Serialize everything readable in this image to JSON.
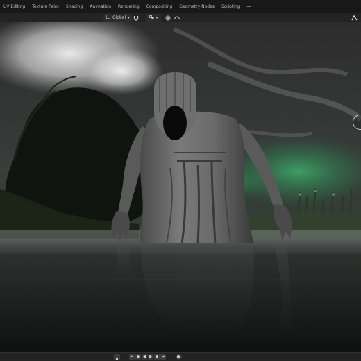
{
  "workspace_tabs": [
    "UV Editing",
    "Texture Paint",
    "Shading",
    "Animation",
    "Rendering",
    "Compositing",
    "Geometry Nodes",
    "Scripting"
  ],
  "add_workspace_label": "+",
  "viewport_header": {
    "transform_orientation": "Global",
    "snap_increment_label": "",
    "icons": {
      "orientation": "orientation-icon",
      "snap": "magnet-icon",
      "snap_increment": "snap-increment-icon",
      "proportional": "proportional-edit-icon",
      "falloff": "falloff-icon",
      "right_tools": "gizmo-toggle-icon"
    }
  },
  "timeline": {
    "buttons": [
      "jump-to-start",
      "jump-to-keyframe-prev",
      "play-reverse",
      "play",
      "jump-to-keyframe-next",
      "jump-to-end"
    ],
    "button_glyphs": [
      "⏮",
      "◆",
      "◀",
      "▶",
      "◆",
      "⏭"
    ]
  },
  "colors": {
    "aurora": "#2f9a5a",
    "ui_dark": "#181818",
    "ui_header": "#232323"
  }
}
